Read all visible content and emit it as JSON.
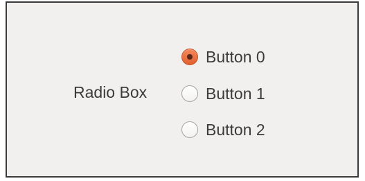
{
  "radio_box": {
    "label": "Radio Box",
    "options": [
      {
        "label": "Button 0",
        "selected": true
      },
      {
        "label": "Button 1",
        "selected": false
      },
      {
        "label": "Button 2",
        "selected": false
      }
    ]
  },
  "colors": {
    "accent": "#e66a3c",
    "window_bg": "#f1f0ee",
    "text": "#3c3c3c"
  }
}
